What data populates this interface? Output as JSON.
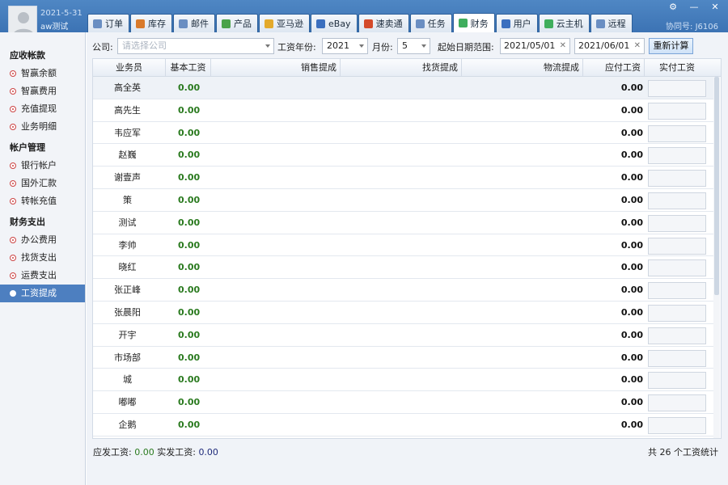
{
  "user": {
    "date": "2021-5-31",
    "name": "aw测试"
  },
  "assoc_label": "协同号: J6106",
  "window_controls": {
    "settings": "⚙",
    "minimize": "—",
    "close": "✕"
  },
  "tabs": [
    {
      "label": "订单",
      "icon": "order-icon",
      "color": "#6a8ec2"
    },
    {
      "label": "库存",
      "icon": "inventory-icon",
      "color": "#d97a2b"
    },
    {
      "label": "邮件",
      "icon": "mail-icon",
      "color": "#6a8ec2"
    },
    {
      "label": "产品",
      "icon": "product-icon",
      "color": "#4aa24a"
    },
    {
      "label": "亚马逊",
      "icon": "amazon-icon",
      "color": "#e3a92b"
    },
    {
      "label": "eBay",
      "icon": "ebay-icon",
      "color": "#3b6fbf"
    },
    {
      "label": "速卖通",
      "icon": "aliexpress-icon",
      "color": "#d44a2b"
    },
    {
      "label": "任务",
      "icon": "task-icon",
      "color": "#6a8ec2"
    },
    {
      "label": "财务",
      "icon": "finance-icon",
      "color": "#3fae5d",
      "active": true
    },
    {
      "label": "用户",
      "icon": "user-icon",
      "color": "#3b6fbf"
    },
    {
      "label": "云主机",
      "icon": "cloud-icon",
      "color": "#3fae5d"
    },
    {
      "label": "远程",
      "icon": "remote-icon",
      "color": "#6a8ec2"
    }
  ],
  "sidebar": {
    "sections": [
      {
        "title": "应收帐款",
        "items": [
          "智赢余额",
          "智赢费用",
          "充值提现",
          "业务明细"
        ]
      },
      {
        "title": "帐户管理",
        "items": [
          "银行帐户",
          "国外汇款",
          "转帐充值"
        ]
      },
      {
        "title": "财务支出",
        "items": [
          "办公费用",
          "找货支出",
          "运费支出",
          "工资提成"
        ]
      }
    ],
    "active_item": "工资提成"
  },
  "filters": {
    "company_label": "公司:",
    "company_placeholder": "请选择公司",
    "year_label": "工资年份:",
    "year_value": "2021",
    "month_label": "月份:",
    "month_value": "5",
    "range_label": "起始日期范围:",
    "start_date": "2021/05/01",
    "end_date": "2021/06/01",
    "clear_glyph": "✕",
    "recalc_label": "重新计算"
  },
  "table": {
    "headers": [
      "业务员",
      "基本工资",
      "销售提成",
      "找货提成",
      "物流提成",
      "应付工资",
      "实付工资"
    ],
    "rows": [
      {
        "name": "高全英",
        "base": "0.00",
        "due": "0.00"
      },
      {
        "name": "高先生",
        "base": "0.00",
        "due": "0.00"
      },
      {
        "name": "韦应军",
        "base": "0.00",
        "due": "0.00"
      },
      {
        "name": "赵巍",
        "base": "0.00",
        "due": "0.00"
      },
      {
        "name": "谢壹声",
        "base": "0.00",
        "due": "0.00"
      },
      {
        "name": "策",
        "base": "0.00",
        "due": "0.00"
      },
      {
        "name": "测试",
        "base": "0.00",
        "due": "0.00"
      },
      {
        "name": "李帅",
        "base": "0.00",
        "due": "0.00"
      },
      {
        "name": "晓红",
        "base": "0.00",
        "due": "0.00"
      },
      {
        "name": "张正峰",
        "base": "0.00",
        "due": "0.00"
      },
      {
        "name": "张晨阳",
        "base": "0.00",
        "due": "0.00"
      },
      {
        "name": "开宇",
        "base": "0.00",
        "due": "0.00"
      },
      {
        "name": "市场部",
        "base": "0.00",
        "due": "0.00"
      },
      {
        "name": "城",
        "base": "0.00",
        "due": "0.00"
      },
      {
        "name": "嘟嘟",
        "base": "0.00",
        "due": "0.00"
      },
      {
        "name": "企鹅",
        "base": "0.00",
        "due": "0.00"
      }
    ]
  },
  "footer": {
    "due_label": "应发工资:",
    "due_value": "0.00",
    "actual_label": "实发工资:",
    "actual_value": "0.00",
    "count_text": "共 26 个工资统计"
  }
}
